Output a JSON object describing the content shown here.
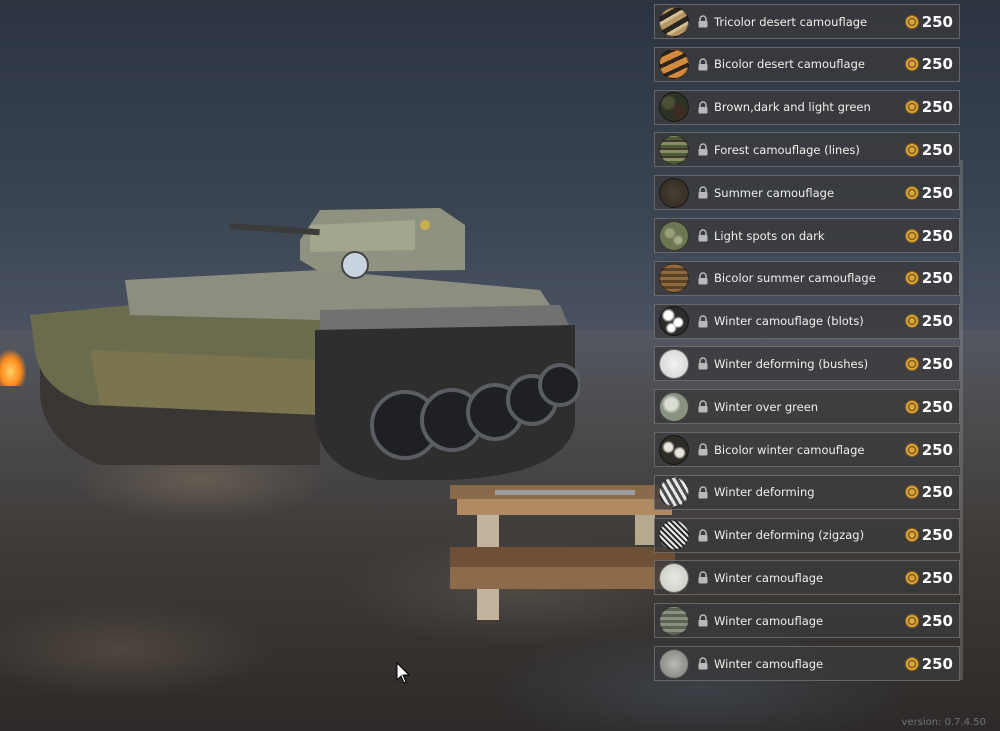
{
  "camouflage_list": {
    "items": [
      {
        "name": "Tricolor desert camouflage",
        "price": "250",
        "swatch": "tiger-sand"
      },
      {
        "name": "Bicolor desert camouflage",
        "price": "250",
        "swatch": "tiger-orange"
      },
      {
        "name": "Brown,dark and light green",
        "price": "250",
        "swatch": "mottled-dark"
      },
      {
        "name": "Forest camouflage (lines)",
        "price": "250",
        "swatch": "lines-green"
      },
      {
        "name": "Summer camouflage",
        "price": "250",
        "swatch": "plain-dark-brown"
      },
      {
        "name": "Light spots on dark",
        "price": "250",
        "swatch": "spots-olive"
      },
      {
        "name": "Bicolor summer camouflage",
        "price": "250",
        "swatch": "stripes-brown"
      },
      {
        "name": "Winter camouflage (blots)",
        "price": "250",
        "swatch": "blots-white"
      },
      {
        "name": "Winter deforming (bushes)",
        "price": "250",
        "swatch": "bushes-white"
      },
      {
        "name": "Winter over green",
        "price": "250",
        "swatch": "winter-green"
      },
      {
        "name": "Bicolor winter camouflage",
        "price": "250",
        "swatch": "bicolor-winter"
      },
      {
        "name": "Winter deforming",
        "price": "250",
        "swatch": "winter-deform"
      },
      {
        "name": "Winter deforming (zigzag)",
        "price": "250",
        "swatch": "zigzag"
      },
      {
        "name": "Winter camouflage",
        "price": "250",
        "swatch": "plain-white"
      },
      {
        "name": "Winter camouflage",
        "price": "250",
        "swatch": "lines-winter"
      },
      {
        "name": "Winter camouflage",
        "price": "250",
        "swatch": "speckle-winter"
      }
    ]
  },
  "footer": {
    "version": "version: 0.7.4.50"
  },
  "colors": {
    "coin": "#d9a53a",
    "item_bg": "#3a3a3c",
    "text": "#f0efe9"
  }
}
